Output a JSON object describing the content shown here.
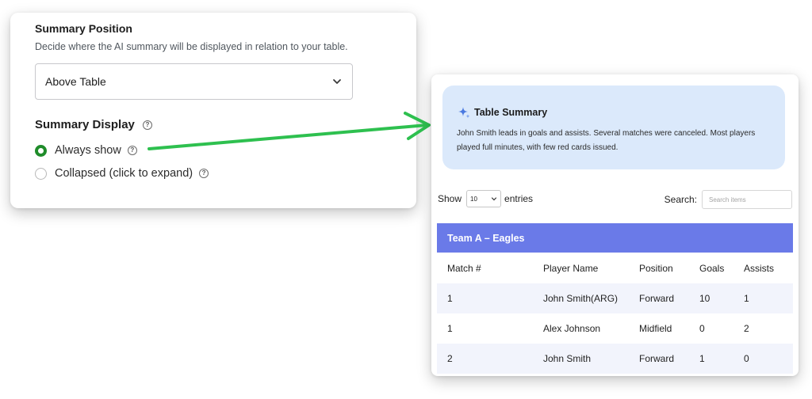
{
  "settings": {
    "summary_position": {
      "title": "Summary Position",
      "description": "Decide where the AI summary will be displayed in relation to your table.",
      "selected": "Above Table"
    },
    "summary_display": {
      "title": "Summary Display",
      "options": [
        {
          "label": "Always show",
          "selected": true
        },
        {
          "label": "Collapsed (click to expand)",
          "selected": false
        }
      ]
    },
    "help_glyph": "?"
  },
  "table_card": {
    "summary": {
      "title": "Table Summary",
      "text": "John Smith leads in goals and assists. Several matches were canceled. Most players played full minutes, with few red cards issued."
    },
    "length": {
      "show_label": "Show",
      "value": "10",
      "entries_label": "entries"
    },
    "search": {
      "label": "Search:",
      "placeholder": "Search items"
    },
    "group_title": "Team A – Eagles",
    "columns": [
      "Match #",
      "Player Name",
      "Position",
      "Goals",
      "Assists"
    ],
    "rows": [
      [
        "1",
        "John Smith(ARG)",
        "Forward",
        "10",
        "1"
      ],
      [
        "1",
        "Alex Johnson",
        "Midfield",
        "0",
        "2"
      ],
      [
        "2",
        "John Smith",
        "Forward",
        "1",
        "0"
      ]
    ]
  },
  "colors": {
    "radio_selected": "#1f8c2a",
    "arrow": "#2ec04f",
    "summary_bg": "#dbe9fb",
    "group_header": "#6a7ae8",
    "sparkle": "#4a79e0"
  },
  "icons": [
    "chevron-down-icon",
    "help-icon",
    "arrow-icon",
    "sparkle-icon"
  ]
}
